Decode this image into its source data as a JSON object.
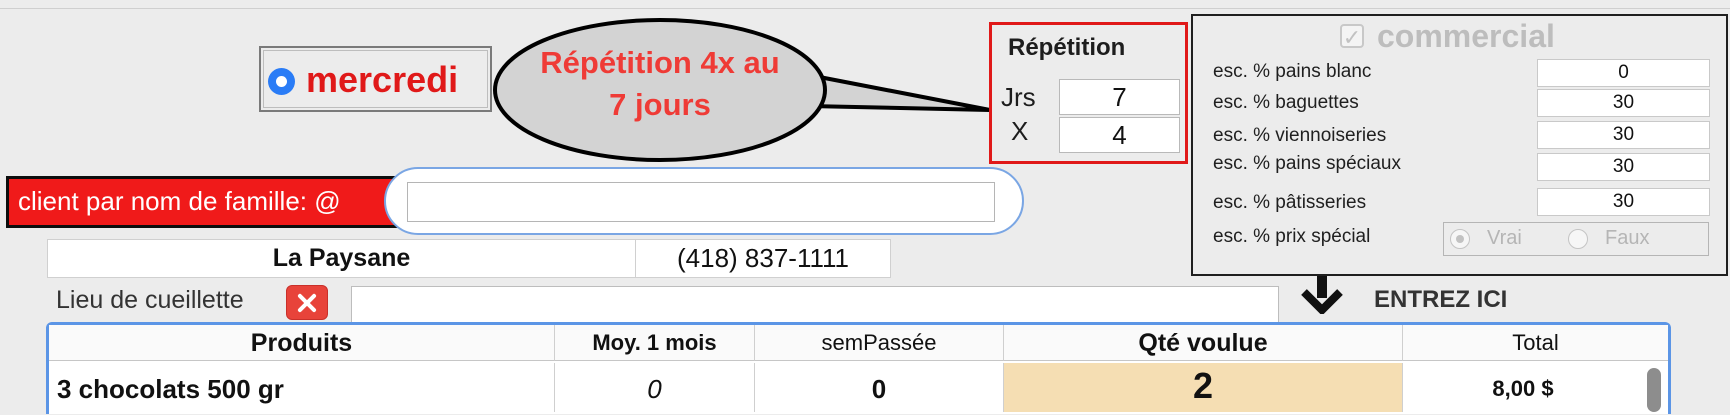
{
  "day": {
    "label": "mercredi"
  },
  "annotation": {
    "line1": "Répétition 4x au",
    "line2": "7 jours"
  },
  "repetition": {
    "title": "Répétition",
    "jours_label": "Jrs",
    "jours_value": "7",
    "x_label": "X",
    "x_value": "4"
  },
  "commercial": {
    "checkbox_mark": "✓",
    "title": "commercial",
    "rows": [
      {
        "label": "esc. % pains blanc",
        "value": "0"
      },
      {
        "label": "esc. % baguettes",
        "value": "30"
      },
      {
        "label": "esc. % viennoiseries",
        "value": "30"
      },
      {
        "label": "esc. % pains spéciaux",
        "value": "30"
      },
      {
        "label": "esc. % pâtisseries",
        "value": "30"
      }
    ],
    "prix_special_label": "esc. % prix spécial",
    "prix_special_options": [
      "Vrai",
      "Faux"
    ],
    "prix_special_selected": "Vrai"
  },
  "client": {
    "label": "client  par nom de famille: @",
    "search_value": ""
  },
  "customer": {
    "name": "La Paysane",
    "phone": "(418) 837-1111"
  },
  "pickup": {
    "label": "Lieu de cueillette",
    "value": ""
  },
  "entry_hint": "ENTREZ ICI",
  "table": {
    "columns": [
      "Produits",
      "Moy. 1 mois",
      "semPassée",
      "Qté voulue",
      "Total"
    ],
    "rows": [
      {
        "produit": "3 chocolats 500 gr",
        "moy": "0",
        "sem": "0",
        "qte": "2",
        "total": "8,00 $"
      }
    ]
  },
  "colors": {
    "alert_red": "#e01919",
    "qty_highlight": "#f5deb3",
    "accent_blue": "#2a7cf6"
  },
  "icons": [
    "radio-selected-icon",
    "checkbox-checked-icon",
    "close-icon",
    "arrow-down-icon"
  ]
}
